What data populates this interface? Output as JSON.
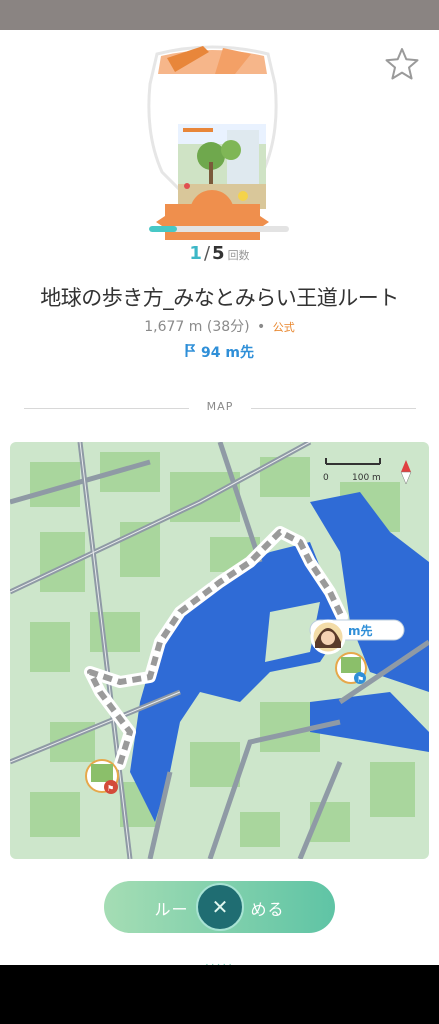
{
  "route": {
    "progress_current": "1",
    "progress_separator": "/",
    "progress_total": "5",
    "progress_unit": "回数",
    "progress_fraction": 0.2,
    "title": "地球の歩き方_みなとみらい王道ルート",
    "distance": "1,677 m (38分)",
    "separator": "•",
    "official_label": "公式",
    "next_distance": "94 m先"
  },
  "map": {
    "section_label": "MAP",
    "scale_zero": "0",
    "scale_distance": "100 m",
    "player_label": "m先"
  },
  "actions": {
    "start_label_left": "ルー",
    "start_label_right": "める",
    "close_symbol": "✕"
  },
  "icons": {
    "favorite": "star-outline-icon",
    "next_marker": "flag-icon",
    "compass": "compass-icon",
    "close": "close-icon"
  },
  "colors": {
    "accent_teal": "#47c8c6",
    "official_orange": "#e8862d",
    "next_blue": "#2f8fd8",
    "water": "#2f6bd6",
    "land": "#cfe6cd",
    "button_green": "#5fc4a5"
  }
}
